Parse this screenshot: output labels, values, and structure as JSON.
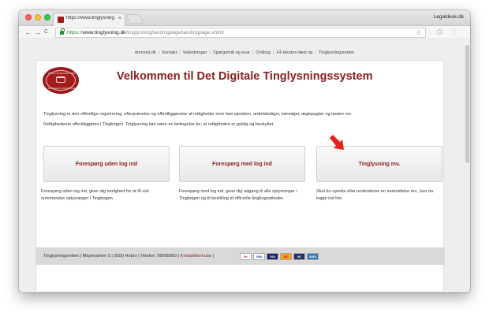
{
  "browser": {
    "tab_title": "https://www.tinglysning.dk/tin",
    "tab_close": "×",
    "profile_name": "Legaldesk.dk",
    "back_icon": "←",
    "forward_icon": "→",
    "reload_icon": "C",
    "url_scheme": "https://",
    "url_host": "www.tinglysning.dk",
    "url_path": "/tinglysning/landingpage/landingpage.xhtml",
    "bookmark_icon": "☆",
    "ext_icon": "⬡",
    "menu_icon": "⋮"
  },
  "toplinks": [
    "domstol.dk",
    "Kontakt",
    "Vejledninger",
    "Spørgsmål og svar",
    "Ordbog",
    "Få teksten læst op",
    "Tinglysningsretten"
  ],
  "logo": {
    "top_text": "TINGLYSNINGSRETTEN",
    "bottom_text": "DANMARKS DOMSTOLE"
  },
  "page": {
    "title": "Velkommen til Det Digitale Tinglysningssystem",
    "intro": "Tinglysning er den offentlige registrering, efterprøvelse og offentliggørelse af rettigheder over fast ejendom, andelsboliger, køretøjer, ægtepagter og løsøre mv.",
    "intro2": "Rettighederne offentliggøres i Tingbogen. Tinglysning kan være en betingelse for, at rettigheden er gyldig og beskyttet."
  },
  "buttons": [
    {
      "label": "Forespørg uden log ind",
      "desc": "Forespørg uden log ind, giver dig mulighed for at få vist summariske oplysninger i Tingbogen."
    },
    {
      "label": "Forespørg med log ind",
      "desc": "Forespørg med log ind, giver dig adgang til alle oplysninger i Tingbogen og til bestilling af officielle tingbogsattester."
    },
    {
      "label": "Tinglysning mv.",
      "desc": "Skal du oprette eller underskrive en anmeldelse mv., kan du logge ind her."
    }
  ],
  "footer": {
    "address": "Tinglysningsretten | Majsmarken 5 | 9500 Hobro | Telefon: 99685800 | ",
    "contact_link": "Kontaktformular",
    "after_link": " |",
    "cards": [
      {
        "label": "DK",
        "bg": "#ffffff",
        "fg": "#c8102e"
      },
      {
        "label": "VISA",
        "bg": "#ffffff",
        "fg": "#1a1f71"
      },
      {
        "label": "VISA",
        "bg": "#1a1f71",
        "fg": "#ffffff"
      },
      {
        "label": "MC",
        "bg": "#f79e1b",
        "fg": "#eb001b"
      },
      {
        "label": "MC",
        "bg": "#2b2b6b",
        "fg": "#ffffff"
      },
      {
        "label": "AMEX",
        "bg": "#2e77bc",
        "fg": "#ffffff"
      }
    ]
  },
  "colors": {
    "brand_red": "#8b1e1e",
    "arrow_red": "#e8211c"
  }
}
